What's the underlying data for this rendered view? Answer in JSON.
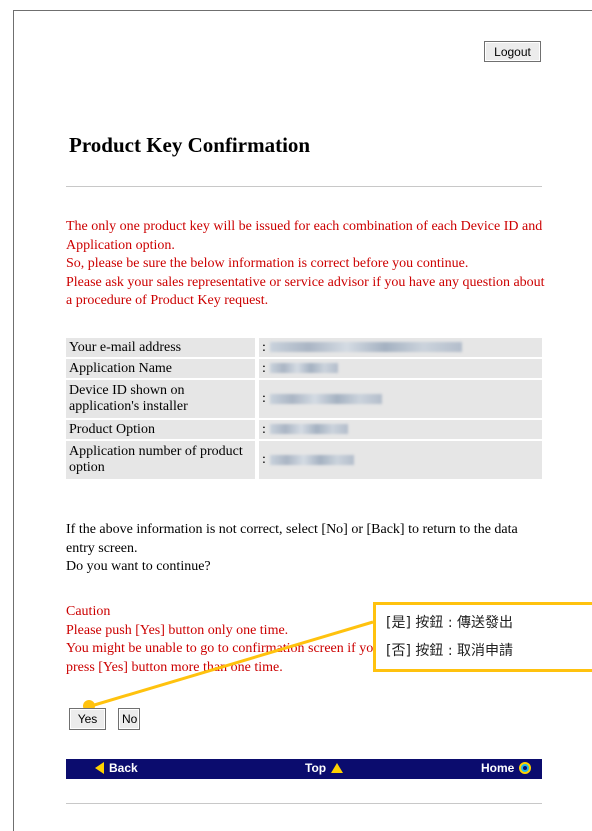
{
  "header": {
    "logout_label": "Logout"
  },
  "page_title": "Product Key Confirmation",
  "warning": [
    "The only one product key will be issued for each combination of each Device ID and Application option.",
    "So, please be sure the below information is correct before you continue.",
    "Please ask your sales representative or service advisor if you have any question about a procedure of Product Key request."
  ],
  "info_table": {
    "separator": ":",
    "rows": [
      {
        "label": "Your e-mail address"
      },
      {
        "label": "Application Name"
      },
      {
        "label": "Device ID shown on application's installer"
      },
      {
        "label": "Product Option"
      },
      {
        "label": "Application number of product option"
      }
    ]
  },
  "confirm": {
    "line1": "If the above information is not correct, select [No] or [Back] to return to the data entry screen.",
    "line2": "Do you want to continue?"
  },
  "caution": {
    "heading": "Caution",
    "line1": "Please push [Yes] button only one time.",
    "line2": "You might be unable to go to confirmation screen if you press [Yes] button more than one time."
  },
  "callout": {
    "line1": "[是] 按鈕 : 傳送發出",
    "line2": "[否] 按鈕 : 取消申請"
  },
  "buttons": {
    "yes_label": "Yes",
    "no_label": "No"
  },
  "nav": {
    "back_label": "Back",
    "top_label": "Top",
    "home_label": "Home"
  },
  "colors": {
    "warning_text": "#cc0000",
    "nav_bar": "#0b0c6e",
    "nav_icons": "#ffd200",
    "callout_border": "#ffc20e"
  }
}
